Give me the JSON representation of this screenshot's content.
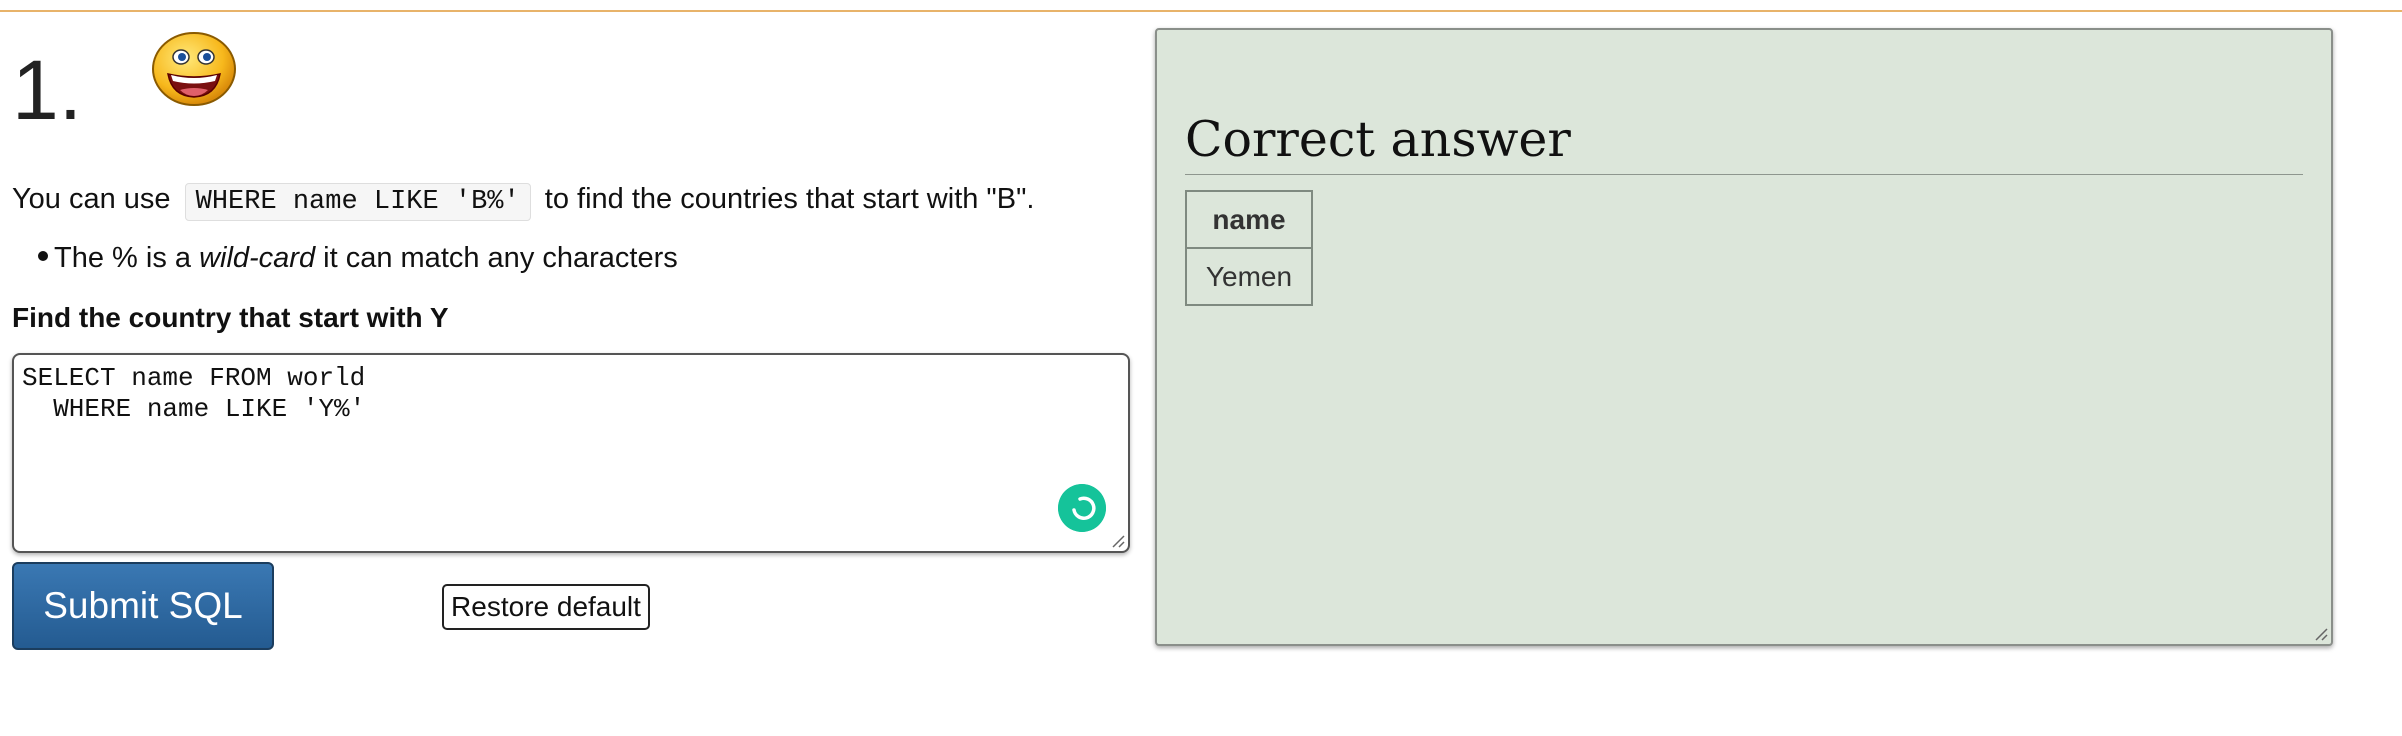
{
  "question": {
    "number": "1.",
    "intro_before": "You can use",
    "intro_code": "WHERE name LIKE 'B%'",
    "intro_after": "to find the countries that start with \"B\".",
    "bullet_before": "The % is a",
    "bullet_em": "wild-card",
    "bullet_after": "it can match any characters",
    "task": "Find the country that start with Y"
  },
  "editor": {
    "sql": "SELECT name FROM world\n  WHERE name LIKE 'Y%'"
  },
  "buttons": {
    "submit_label": "Submit SQL",
    "restore_label": "Restore default"
  },
  "answer": {
    "title": "Correct answer",
    "columns": [
      "name"
    ],
    "rows": [
      [
        "Yemen"
      ]
    ]
  },
  "icons": {
    "status": "smiley-face-icon",
    "assistant": "grammarly-assistant-icon",
    "resize": "resize-grip-icon"
  },
  "colors": {
    "accent_rule": "#e8b36a",
    "submit_bg": "#2d6aa3",
    "answer_bg": "#dce6da",
    "assistant": "#15c39a"
  }
}
